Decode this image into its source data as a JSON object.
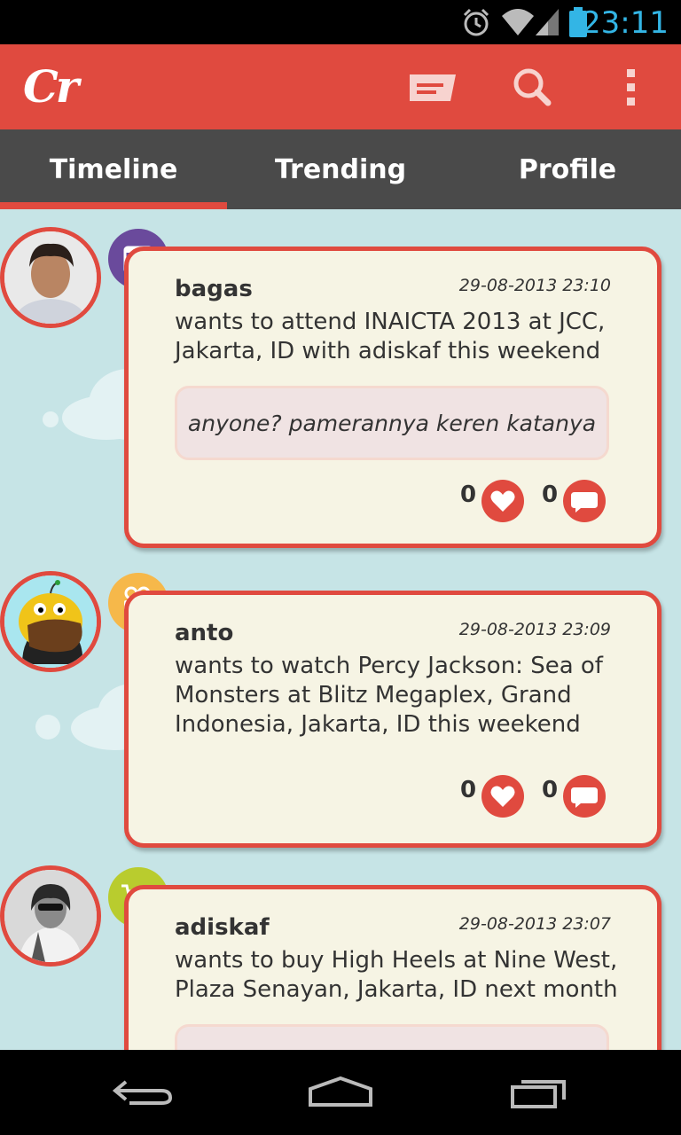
{
  "status_bar": {
    "time": "23:11",
    "icons": [
      "alarm-icon",
      "wifi-icon",
      "signal-icon",
      "battery-icon"
    ]
  },
  "app_bar": {
    "logo": "Cr",
    "actions": [
      "compose-icon",
      "search-icon",
      "overflow-menu-icon"
    ]
  },
  "colors": {
    "brand": "#e04a3f",
    "tabs_bg": "#4a4a4a",
    "feed_bg": "#c6e4e6",
    "card_bg": "#f6f4e4",
    "time": "#33b5e5"
  },
  "tabs": [
    {
      "label": "Timeline",
      "active": true
    },
    {
      "label": "Trending",
      "active": false
    },
    {
      "label": "Profile",
      "active": false
    }
  ],
  "posts": [
    {
      "user": "bagas",
      "timestamp": "29-08-2013 23:10",
      "category_icon": "calendar-icon",
      "message": "wants to attend INAICTA 2013 at JCC, Jakarta, ID with adiskaf this weekend",
      "comment": "anyone? pamerannya keren katanya",
      "likes": "0",
      "comments": "0"
    },
    {
      "user": "anto",
      "timestamp": "29-08-2013 23:09",
      "category_icon": "movie-camera-icon",
      "message": "wants to watch Percy Jackson: Sea of Monsters at Blitz Megaplex, Grand Indonesia, Jakarta, ID this weekend",
      "comment": "",
      "likes": "0",
      "comments": "0"
    },
    {
      "user": "adiskaf",
      "timestamp": "29-08-2013 23:07",
      "category_icon": "shopping-cart-icon",
      "message": "wants to buy High Heels at Nine West, Plaza Senayan, Jakarta, ID next month",
      "comment": "",
      "likes": "",
      "comments": ""
    }
  ],
  "nav_bar": [
    "back-icon",
    "home-icon",
    "recent-apps-icon"
  ]
}
